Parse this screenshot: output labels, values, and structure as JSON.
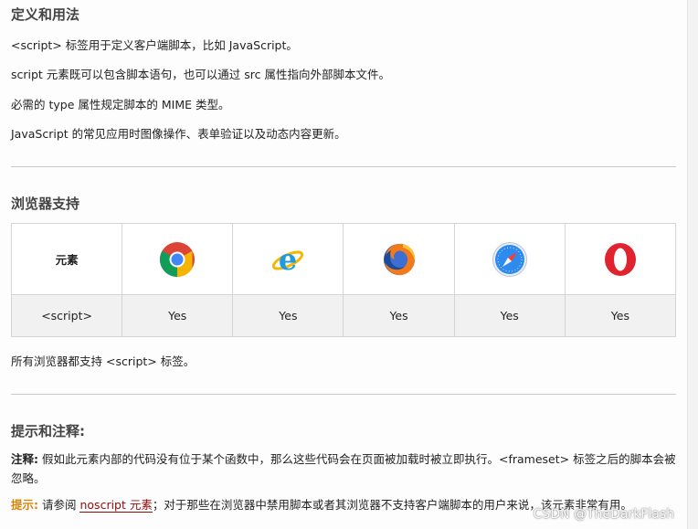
{
  "definition": {
    "heading": "定义和用法",
    "lines": [
      "<script> 标签用于定义客户端脚本，比如 JavaScript。",
      "script 元素既可以包含脚本语句，也可以通过 src 属性指向外部脚本文件。",
      "必需的 type 属性规定脚本的 MIME 类型。",
      "JavaScript 的常见应用时图像操作、表单验证以及动态内容更新。"
    ]
  },
  "browser_support": {
    "heading": "浏览器支持",
    "header_label": "元素",
    "browsers": [
      {
        "icon": "chrome-icon"
      },
      {
        "icon": "internet-explorer-icon"
      },
      {
        "icon": "firefox-icon"
      },
      {
        "icon": "safari-icon"
      },
      {
        "icon": "opera-icon"
      }
    ],
    "row_label": "<script>",
    "row_values": [
      "Yes",
      "Yes",
      "Yes",
      "Yes",
      "Yes"
    ],
    "footer": "所有浏览器都支持 <script> 标签。"
  },
  "tips": {
    "heading": "提示和注释:",
    "note_label": "注释:",
    "note_text": "假如此元素内部的代码没有位于某个函数中，那么这些代码会在页面被加载时被立即执行。<frameset> 标签之后的脚本会被忽略。",
    "tip_label": "提示:",
    "tip_pre": "请参阅",
    "tip_link": "noscript 元素",
    "tip_post": "；对于那些在浏览器中禁用脚本或者其浏览器不支持客户端脚本的用户来说，该元素非常有用。"
  },
  "watermark": "CSDN @TheDarkFlash"
}
